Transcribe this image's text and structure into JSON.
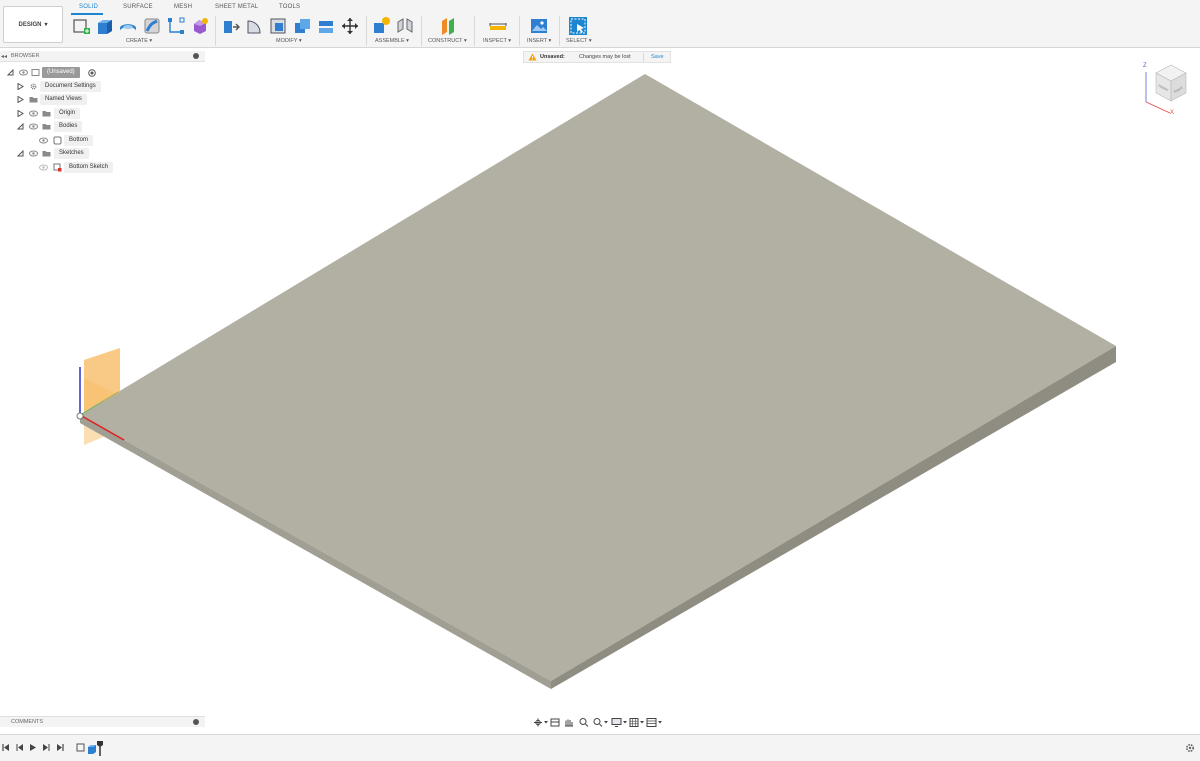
{
  "workspace": {
    "label": "DESIGN"
  },
  "tabs": [
    {
      "label": "SOLID",
      "active": true
    },
    {
      "label": "SURFACE",
      "active": false
    },
    {
      "label": "MESH",
      "active": false
    },
    {
      "label": "SHEET METAL",
      "active": false
    },
    {
      "label": "TOOLS",
      "active": false
    }
  ],
  "groups": {
    "create": "CREATE",
    "modify": "MODIFY",
    "assemble": "ASSEMBLE",
    "construct": "CONSTRUCT",
    "inspect": "INSPECT",
    "insert": "INSERT",
    "select": "SELECT"
  },
  "browser": {
    "title": "BROWSER",
    "items": [
      {
        "label": "(Unsaved)"
      },
      {
        "label": "Document Settings"
      },
      {
        "label": "Named Views"
      },
      {
        "label": "Origin"
      },
      {
        "label": "Bodies"
      },
      {
        "label": "Bottom"
      },
      {
        "label": "Sketches"
      },
      {
        "label": "Bottom Sketch"
      }
    ]
  },
  "notice": {
    "status": "Unsaved:",
    "message": "Changes may be lost",
    "save_label": "Save"
  },
  "comments": {
    "title": "COMMENTS"
  },
  "viewcube": {
    "axis_z": "Z",
    "axis_x": "X",
    "face_front": "FRONT",
    "face_right": "RIGHT"
  },
  "colors": {
    "accent": "#1c86d1",
    "body_top": "#b2afa3",
    "body_front": "#a19e93",
    "body_side": "#8f8c82",
    "warning": "#f0a30a"
  }
}
